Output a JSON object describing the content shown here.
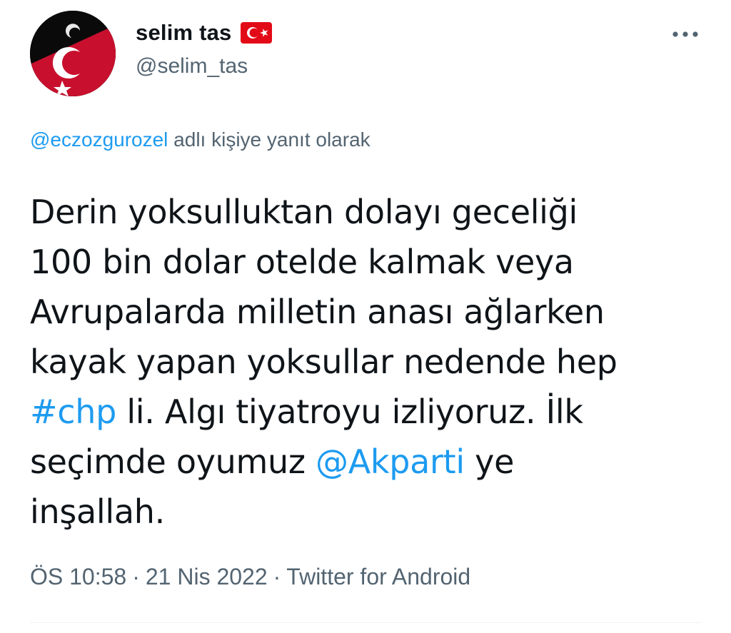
{
  "author": {
    "display_name": "selim tas",
    "username": "@selim_tas",
    "flag_icon": "turkey-flag-icon"
  },
  "reply_context": {
    "mention": "@eczozgurozel",
    "text": " adlı kişiye yanıt olarak"
  },
  "tweet": {
    "line1": "Derin yoksulluktan dolayı geceliği",
    "line2": "100 bin dolar otelde kalmak veya",
    "line3": "Avrupalarda milletin anası ağlarken",
    "line4": "kayak yapan yoksullar nedende hep",
    "hashtag": "#chp",
    "line5_rest": " li. Algı tiyatroyu izliyoruz. İlk",
    "line6_pre": "seçimde oyumuz ",
    "mention": "@Akparti",
    "line6_post": " ye",
    "line7": "inşallah."
  },
  "meta": {
    "time": "ÖS 10:58",
    "date": "21 Nis 2022",
    "separator": "·",
    "source": "Twitter for Android"
  },
  "colors": {
    "link": "#1d9bf0",
    "secondary_text": "#536471",
    "primary_text": "#0f1419"
  }
}
